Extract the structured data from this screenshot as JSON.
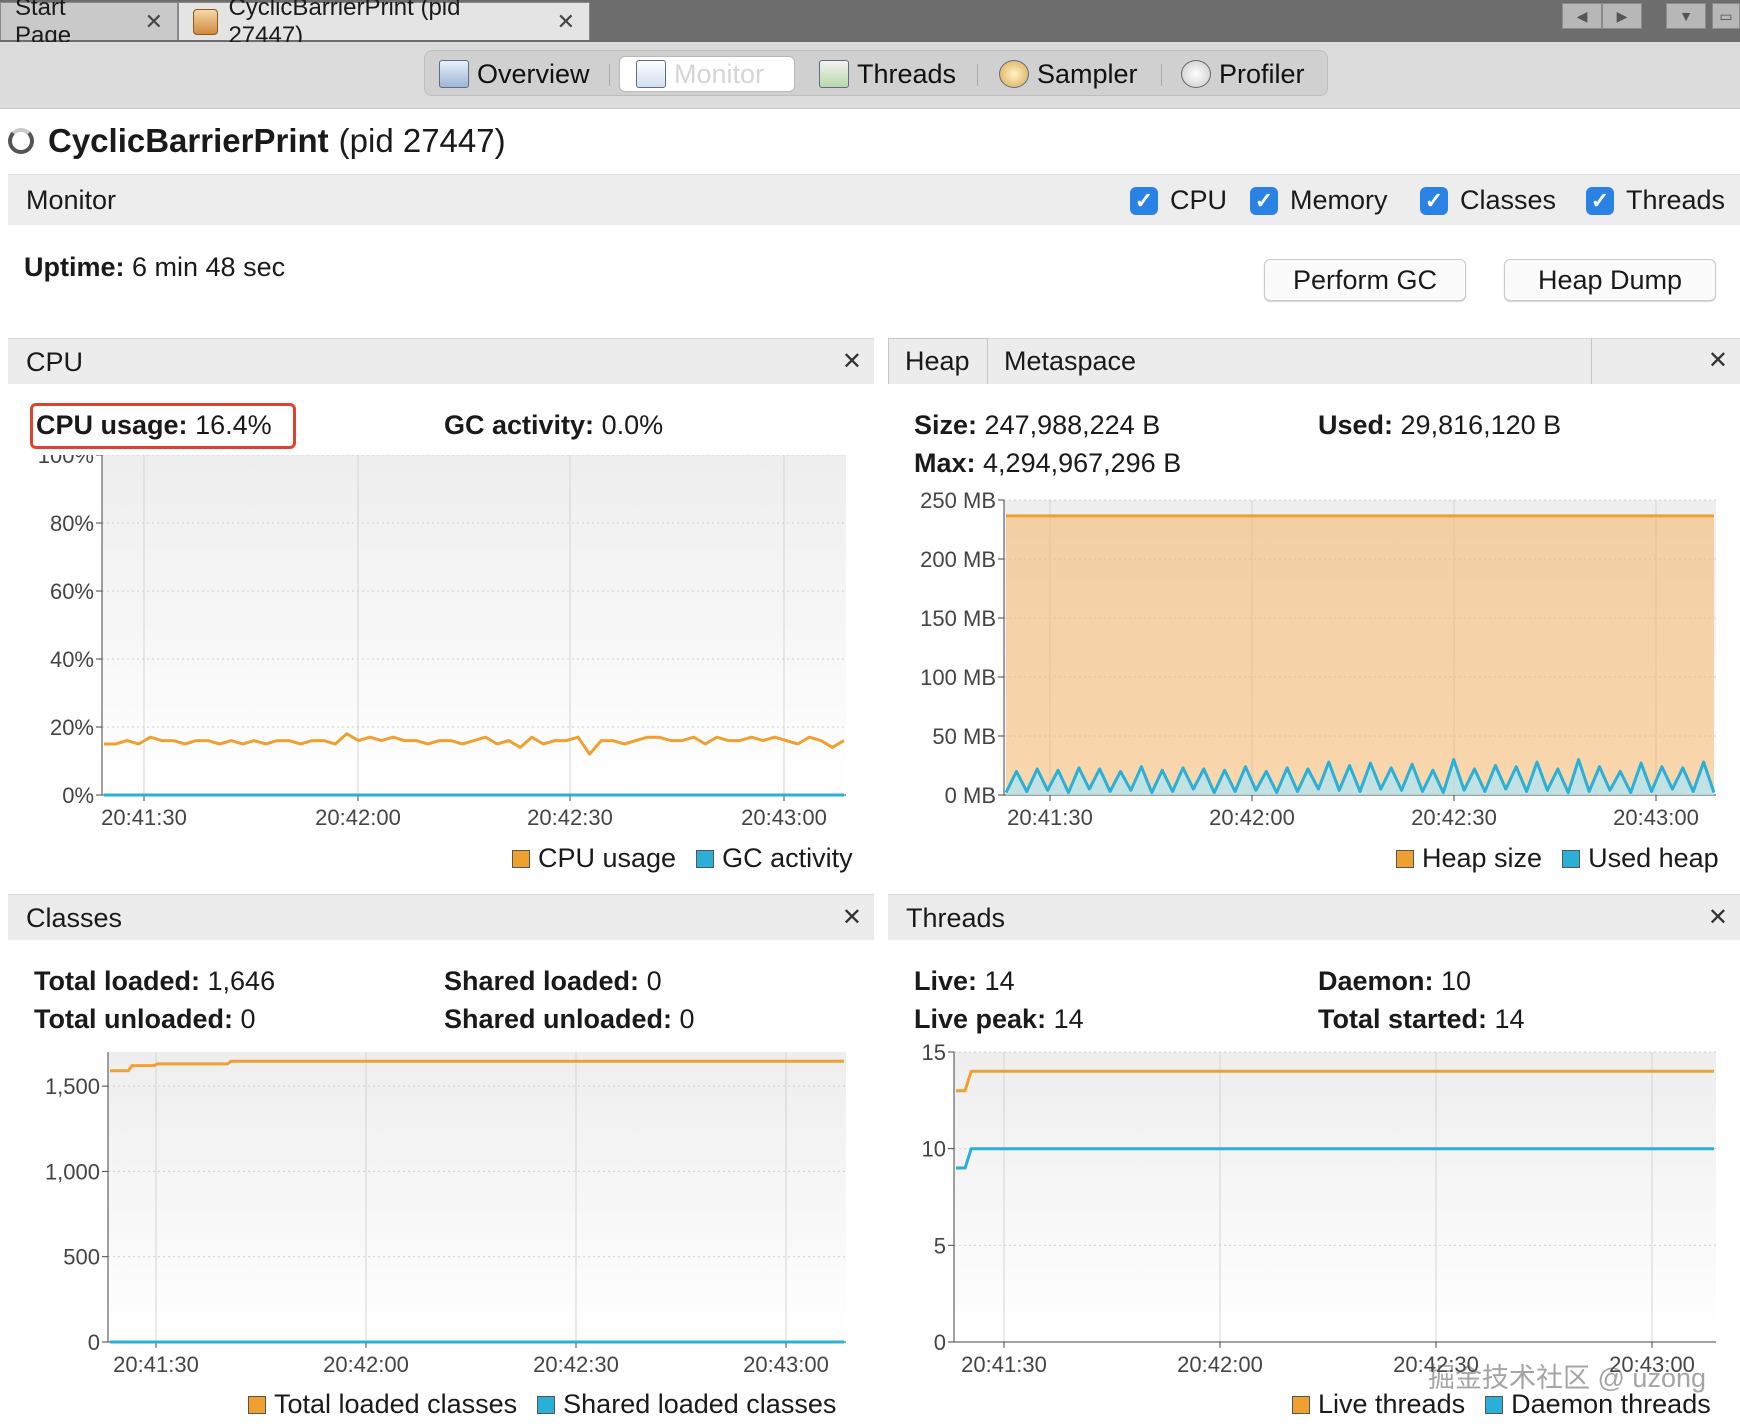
{
  "tabs": [
    {
      "label": "Start Page"
    },
    {
      "label": "CyclicBarrierPrint (pid 27447)"
    }
  ],
  "toolbar": [
    {
      "label": "Overview"
    },
    {
      "label": "Monitor"
    },
    {
      "label": "Threads"
    },
    {
      "label": "Sampler"
    },
    {
      "label": "Profiler"
    }
  ],
  "title": {
    "name": "CyclicBarrierPrint",
    "pid": "(pid 27447)"
  },
  "monitor": {
    "label": "Monitor",
    "checks": [
      {
        "label": "CPU",
        "checked": true
      },
      {
        "label": "Memory",
        "checked": true
      },
      {
        "label": "Classes",
        "checked": true
      },
      {
        "label": "Threads",
        "checked": true
      }
    ],
    "uptime_label": "Uptime:",
    "uptime_value": "6 min 48 sec",
    "perform_gc": "Perform GC",
    "heap_dump": "Heap Dump"
  },
  "cpu": {
    "title": "CPU",
    "usage_label": "CPU usage:",
    "usage_value": "16.4%",
    "gc_label": "GC activity:",
    "gc_value": "0.0%",
    "legend": [
      "CPU usage",
      "GC activity"
    ]
  },
  "heap": {
    "tabs": [
      "Heap",
      "Metaspace"
    ],
    "size_label": "Size:",
    "size_value": "247,988,224 B",
    "used_label": "Used:",
    "used_value": "29,816,120 B",
    "max_label": "Max:",
    "max_value": "4,294,967,296 B",
    "legend": [
      "Heap size",
      "Used heap"
    ]
  },
  "classes": {
    "title": "Classes",
    "total_loaded_label": "Total loaded:",
    "total_loaded_value": "1,646",
    "total_unloaded_label": "Total unloaded:",
    "total_unloaded_value": "0",
    "shared_loaded_label": "Shared loaded:",
    "shared_loaded_value": "0",
    "shared_unloaded_label": "Shared unloaded:",
    "shared_unloaded_value": "0",
    "legend": [
      "Total loaded classes",
      "Shared loaded classes"
    ]
  },
  "threads": {
    "title": "Threads",
    "live_label": "Live:",
    "live_value": "14",
    "live_peak_label": "Live peak:",
    "live_peak_value": "14",
    "daemon_label": "Daemon:",
    "daemon_value": "10",
    "total_started_label": "Total started:",
    "total_started_value": "14",
    "legend": [
      "Live threads",
      "Daemon threads"
    ]
  },
  "colors": {
    "orange": "#f0a030",
    "blue": "#2ab0d8"
  },
  "watermark": "掘金技术社区 @ uzong",
  "chart_data": [
    {
      "type": "line",
      "ylabels": [
        "100%",
        "80%",
        "60%",
        "40%",
        "20%",
        "0%"
      ],
      "ylim": [
        0,
        100
      ],
      "xlabels": [
        "20:41:30",
        "20:42:00",
        "20:42:30",
        "20:43:00"
      ],
      "series": [
        {
          "name": "CPU usage",
          "color": "#f0a030",
          "values": [
            15,
            15,
            16,
            15,
            17,
            16,
            16,
            15,
            16,
            16,
            15,
            16,
            15,
            16,
            15,
            16,
            16,
            15,
            16,
            16,
            15,
            18,
            16,
            17,
            16,
            17,
            16,
            16,
            15,
            16,
            16,
            15,
            16,
            17,
            15,
            16,
            14,
            17,
            15,
            16,
            16,
            17,
            12,
            16,
            16,
            15,
            16,
            17,
            17,
            16,
            16,
            17,
            15,
            17,
            16,
            16,
            17,
            16,
            17,
            16,
            15,
            17,
            16,
            14,
            16
          ]
        },
        {
          "name": "GC activity",
          "color": "#2ab0d8",
          "values": [
            0,
            0
          ]
        }
      ]
    },
    {
      "type": "area",
      "ylabels": [
        "250 MB",
        "200 MB",
        "150 MB",
        "100 MB",
        "50 MB",
        "0 MB"
      ],
      "ylim": [
        0,
        250
      ],
      "xlabels": [
        "20:41:30",
        "20:42:00",
        "20:42:30",
        "20:43:00"
      ],
      "series": [
        {
          "name": "Heap size",
          "color": "#f0a030",
          "values": [
            236.5,
            236.5
          ]
        },
        {
          "name": "Used heap",
          "color": "#2ab0d8",
          "values": [
            2,
            20,
            3,
            22,
            4,
            21,
            2,
            23,
            5,
            22,
            3,
            20,
            4,
            24,
            2,
            21,
            3,
            23,
            5,
            22,
            2,
            21,
            3,
            24,
            4,
            20,
            2,
            23,
            3,
            22,
            5,
            28,
            4,
            25,
            3,
            27,
            5,
            23,
            4,
            26,
            3,
            21,
            2,
            30,
            4,
            22,
            3,
            25,
            5,
            24,
            3,
            28,
            4,
            22,
            2,
            30,
            3,
            24,
            4,
            20,
            2,
            27,
            3,
            24,
            5,
            23,
            3,
            28,
            2
          ]
        }
      ]
    },
    {
      "type": "line",
      "ylabels": [
        "1,500",
        "1,000",
        "500",
        "0"
      ],
      "ylim": [
        0,
        1700
      ],
      "xlabels": [
        "20:41:30",
        "20:42:00",
        "20:42:30",
        "20:43:00"
      ],
      "series": [
        {
          "name": "Total loaded classes",
          "color": "#f0a030",
          "x": [
            0,
            0.025,
            0.03,
            0.06,
            0.065,
            0.16,
            0.165,
            1
          ],
          "values": [
            1590,
            1590,
            1620,
            1620,
            1630,
            1630,
            1646,
            1646
          ]
        },
        {
          "name": "Shared loaded classes",
          "color": "#2ab0d8",
          "x": [
            0,
            1
          ],
          "values": [
            0,
            0
          ]
        }
      ]
    },
    {
      "type": "line",
      "ylabels": [
        "15",
        "10",
        "5",
        "0"
      ],
      "ylim": [
        0,
        15
      ],
      "xlabels": [
        "20:41:30",
        "20:42:00",
        "20:42:30",
        "20:43:00"
      ],
      "series": [
        {
          "name": "Live threads",
          "color": "#f0a030",
          "x": [
            0,
            0.012,
            0.02,
            1
          ],
          "values": [
            13,
            13,
            14,
            14
          ]
        },
        {
          "name": "Daemon threads",
          "color": "#2ab0d8",
          "x": [
            0,
            0.012,
            0.02,
            1
          ],
          "values": [
            9,
            9,
            10,
            10
          ]
        }
      ]
    }
  ]
}
